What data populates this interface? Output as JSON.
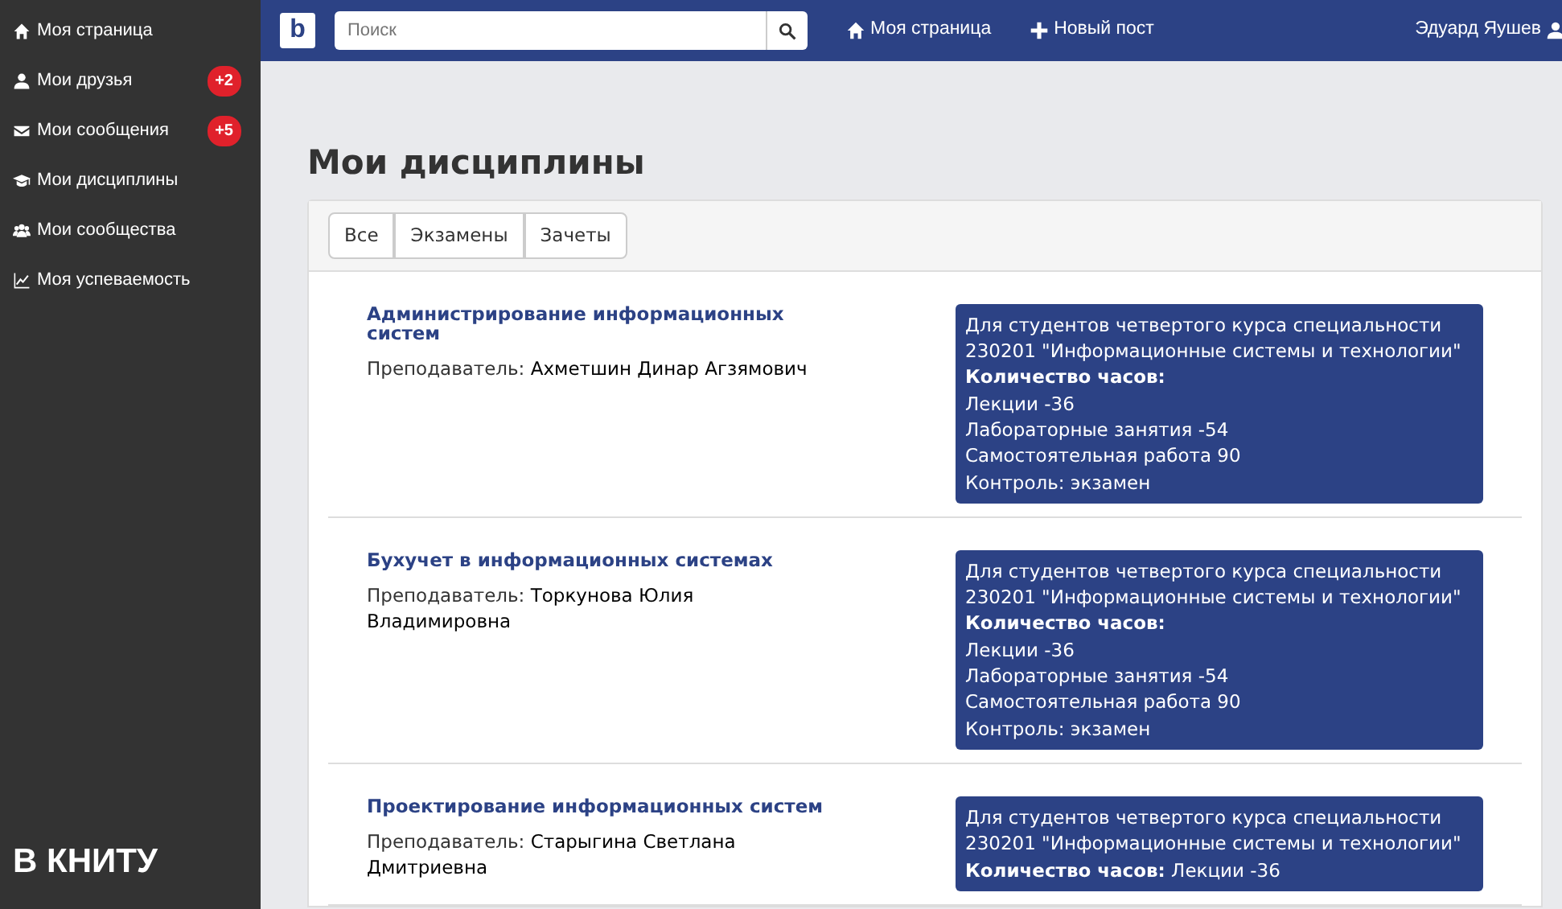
{
  "sidebar": {
    "items": [
      {
        "label": "Моя страница"
      },
      {
        "label": "Мои друзья",
        "badge": "+2"
      },
      {
        "label": "Мои сообщения",
        "badge": "+5"
      },
      {
        "label": "Мои дисциплины"
      },
      {
        "label": "Мои сообщества"
      },
      {
        "label": "Моя успеваемость"
      }
    ],
    "footer": "В КНИТУ"
  },
  "navbar": {
    "logo": "b",
    "search": {
      "placeholder": "Поиск"
    },
    "links": [
      {
        "label": "Моя страница"
      },
      {
        "label": "Новый пост"
      }
    ],
    "user": "Эдуард Яушев"
  },
  "page_title": "Мои дисциплины",
  "filters": [
    {
      "label": "Все",
      "selected": false
    },
    {
      "label": "Экзамены",
      "selected": false
    },
    {
      "label": "Зачеты",
      "selected": false
    }
  ],
  "disciplines": [
    {
      "title": "Администрирование информационных систем",
      "teacher_label": "Преподаватель:",
      "teacher": "Ахметшин Динар Агзямович",
      "info": [
        "Для студентов четвертого курса специальности",
        "230201 \"Информационные системы и технологии\"",
        "**Количество часов:**",
        "Лекции -36",
        "Лабораторные занятия -54",
        "Самостоятельная работа 90",
        "Контроль: экзамен"
      ]
    },
    {
      "title": "Бухучет в информационных системах",
      "teacher_label": "Преподаватель:",
      "teacher": "Торкунова Юлия Владимировна",
      "info": [
        "Для студентов четвертого курса специальности",
        "230201 \"Информационные системы и технологии\"",
        "**Количество часов:**",
        "Лекции -36",
        "Лабораторные занятия -54",
        "Самостоятельная работа 90",
        "Контроль: экзамен"
      ]
    },
    {
      "title": "Проектирование информационных систем",
      "teacher_label": "Преподаватель:",
      "teacher": "Старыгина Светлана Дмитриевна",
      "info": [
        "Для студентов четвертого курса специальности",
        "230201 \"Информационные системы и технологии\"",
        "**Количество часов:** Лекции -36"
      ]
    }
  ]
}
